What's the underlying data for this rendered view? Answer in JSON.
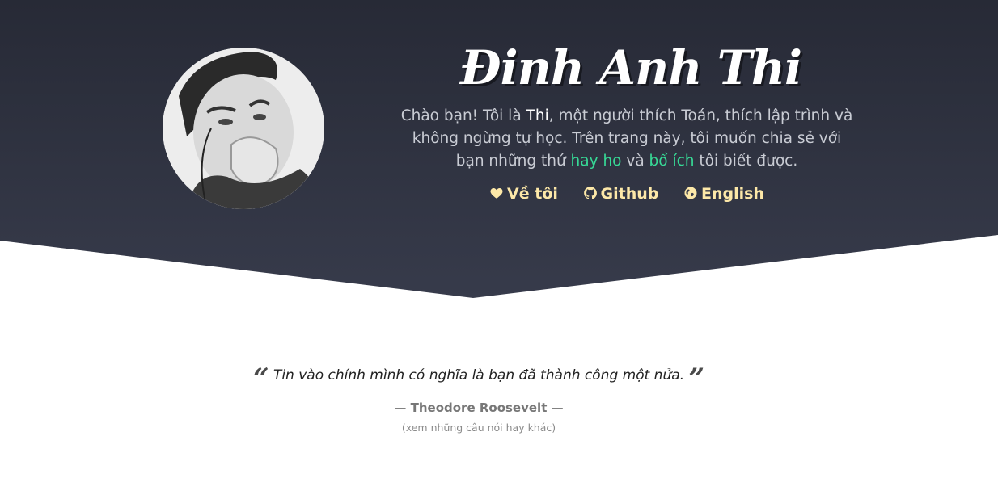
{
  "profile": {
    "name": "Đinh Anh Thi",
    "avatar_alt": "avatar"
  },
  "bio": {
    "part1": "Chào bạn! Tôi là ",
    "name": "Thi",
    "part2": ", một người thích Toán, thích lập trình và không ngừng tự học. Trên trang này, tôi muốn chia sẻ với bạn những thứ ",
    "highlight1": "hay ho",
    "part3": " và ",
    "highlight2": "bổ ích",
    "part4": " tôi biết được."
  },
  "nav_links": {
    "about": "Về tôi",
    "github": "Github",
    "english": "English"
  },
  "quote": {
    "text": "Tin vào chính mình có nghĩa là bạn đã thành công một nửa.",
    "open_mark": "“",
    "close_mark": "”",
    "author": "— Theodore Roosevelt —",
    "more_link": "(xem những câu nói hay khác)"
  },
  "colors": {
    "hero_top": "#272a36",
    "hero_bottom": "#373b4b",
    "link": "#fde8a8",
    "highlight": "#37d996"
  },
  "icons": {
    "about": "heart-icon",
    "github": "github-icon",
    "english": "globe-icon"
  }
}
